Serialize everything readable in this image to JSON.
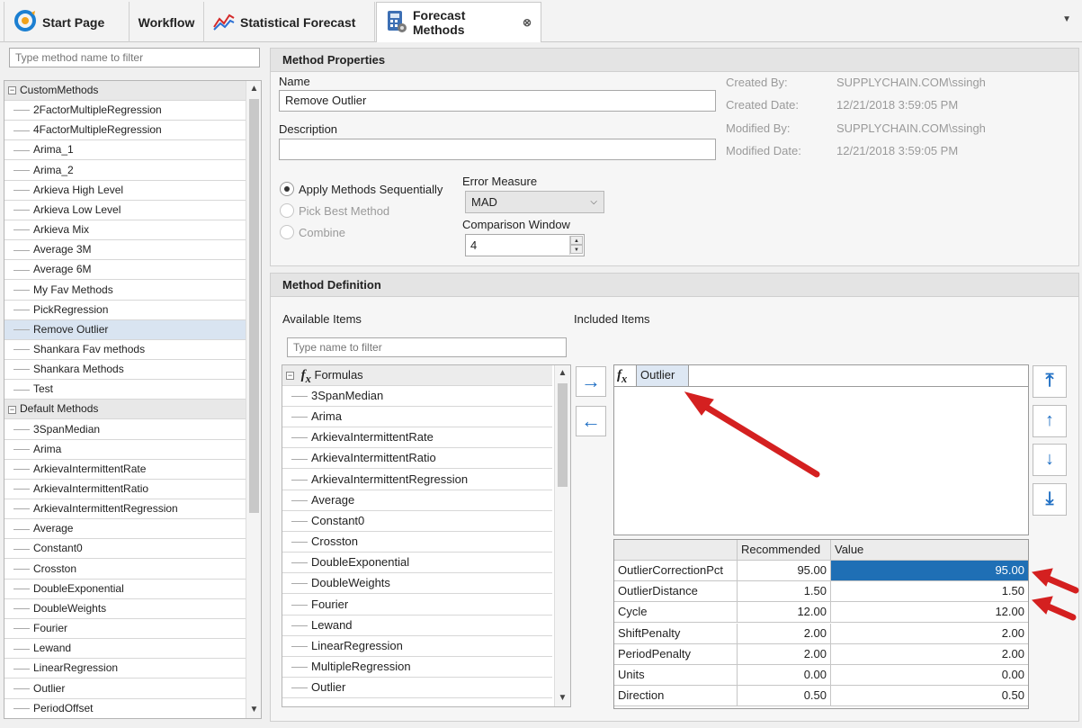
{
  "tabs": [
    {
      "label": "Start Page",
      "icon": "start-page-icon"
    },
    {
      "label": "Workflow"
    },
    {
      "label": "Statistical Forecast",
      "icon": "statistical-forecast-icon"
    },
    {
      "label": "Forecast Methods",
      "icon": "calculator-icon",
      "active": true,
      "close_icon": "⊗"
    }
  ],
  "left": {
    "filter_placeholder": "Type method name to filter",
    "groups": [
      {
        "label": "CustomMethods",
        "items": [
          "2FactorMultipleRegression",
          "4FactorMultipleRegression",
          "Arima_1",
          "Arima_2",
          "Arkieva High Level",
          "Arkieva Low Level",
          "Arkieva Mix",
          "Average 3M",
          "Average 6M",
          "My Fav Methods",
          "PickRegression",
          "Remove Outlier",
          "Shankara Fav methods",
          "Shankara Methods",
          "Test"
        ]
      },
      {
        "label": "Default Methods",
        "items": [
          "3SpanMedian",
          "Arima",
          "ArkievaIntermittentRate",
          "ArkievaIntermittentRatio",
          "ArkievaIntermittentRegression",
          "Average",
          "Constant0",
          "Crosston",
          "DoubleExponential",
          "DoubleWeights",
          "Fourier",
          "Lewand",
          "LinearRegression",
          "Outlier",
          "PeriodOffset"
        ]
      }
    ],
    "selected": "Remove Outlier"
  },
  "props": {
    "title": "Method Properties",
    "name_label": "Name",
    "name_value": "Remove Outlier",
    "desc_label": "Description",
    "desc_value": "",
    "created_by_label": "Created By:",
    "created_by": "SUPPLYCHAIN.COM\\ssingh",
    "created_date_label": "Created Date:",
    "created_date": "12/21/2018 3:59:05 PM",
    "modified_by_label": "Modified By:",
    "modified_by": "SUPPLYCHAIN.COM\\ssingh",
    "modified_date_label": "Modified Date:",
    "modified_date": "12/21/2018 3:59:05 PM",
    "radio_sequential": "Apply Methods Sequentially",
    "radio_pick_best": "Pick Best Method",
    "radio_combine": "Combine",
    "error_measure_label": "Error Measure",
    "error_measure": "MAD",
    "comparison_window_label": "Comparison Window",
    "comparison_window": "4"
  },
  "definition": {
    "title": "Method Definition",
    "available_label": "Available Items",
    "included_label": "Included Items",
    "filter_placeholder": "Type name to filter",
    "formulas_label": "Formulas",
    "formulas": [
      "3SpanMedian",
      "Arima",
      "ArkievaIntermittentRate",
      "ArkievaIntermittentRatio",
      "ArkievaIntermittentRegression",
      "Average",
      "Constant0",
      "Crosston",
      "DoubleExponential",
      "DoubleWeights",
      "Fourier",
      "Lewand",
      "LinearRegression",
      "MultipleRegression",
      "Outlier"
    ],
    "included_items": [
      "Outlier"
    ],
    "grid": {
      "headers": [
        "",
        "Recommended",
        "Value"
      ],
      "rows": [
        {
          "name": "OutlierCorrectionPct",
          "recommended": "95.00",
          "value": "95.00"
        },
        {
          "name": "OutlierDistance",
          "recommended": "1.50",
          "value": "1.50"
        },
        {
          "name": "Cycle",
          "recommended": "12.00",
          "value": "12.00"
        },
        {
          "name": "ShiftPenalty",
          "recommended": "2.00",
          "value": "2.00"
        },
        {
          "name": "PeriodPenalty",
          "recommended": "2.00",
          "value": "2.00"
        },
        {
          "name": "Units",
          "recommended": "0.00",
          "value": "0.00"
        },
        {
          "name": "Direction",
          "recommended": "0.50",
          "value": "0.50"
        }
      ]
    }
  },
  "colors": {
    "selection": "#1f6fb5",
    "annotation": "#d42020",
    "button_accent": "#1f6fc4"
  }
}
